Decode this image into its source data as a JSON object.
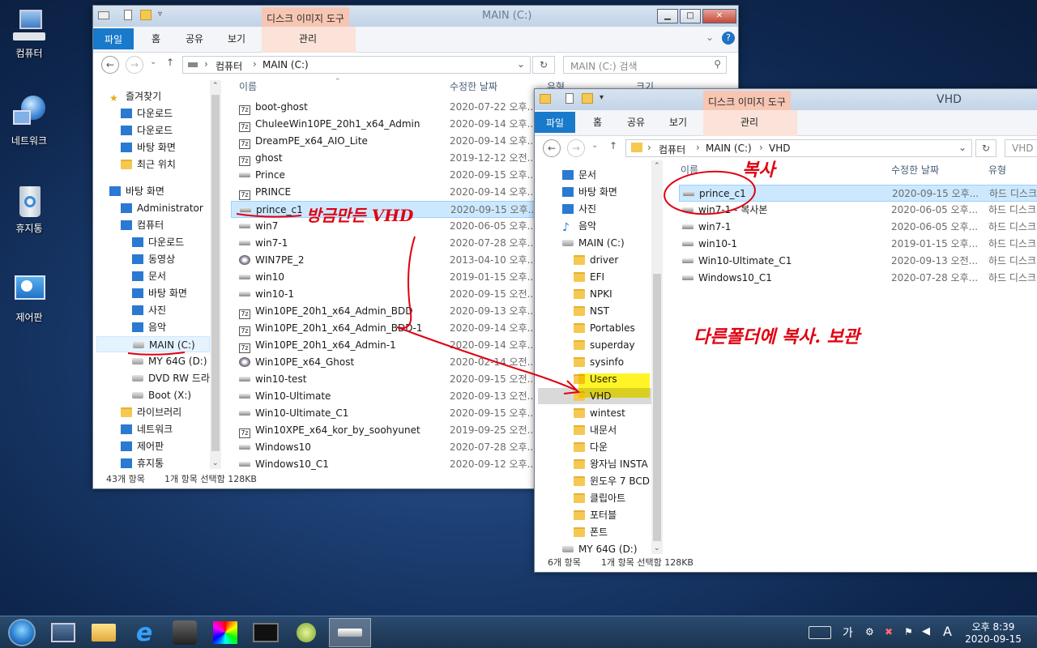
{
  "desktop": {
    "icons": [
      {
        "label": "컴퓨터"
      },
      {
        "label": "네트워크"
      },
      {
        "label": "휴지통"
      },
      {
        "label": "제어판"
      }
    ]
  },
  "win1": {
    "title": "MAIN (C:)",
    "context_tab": "디스크 이미지 도구",
    "tabs": {
      "file": "파일",
      "home": "홈",
      "share": "공유",
      "view": "보기",
      "manage": "관리"
    },
    "address": {
      "computer": "컴퓨터",
      "drive": "MAIN (C:)"
    },
    "search_placeholder": "MAIN (C:) 검색",
    "columns": {
      "name": "이름",
      "date": "수정한 날짜",
      "type": "유형",
      "size": "크기"
    },
    "nav": [
      "즐겨찾기",
      "다운로드",
      "다운로드",
      "바탕 화면",
      "최근 위치",
      "바탕 화면",
      "Administrator",
      "컴퓨터",
      "다운로드",
      "동영상",
      "문서",
      "바탕 화면",
      "사진",
      "음악",
      "MAIN (C:)",
      "MY 64G (D:)",
      "DVD RW 드라이",
      "Boot (X:)",
      "라이브러리",
      "네트워크",
      "제어판",
      "휴지통"
    ],
    "files": [
      {
        "name": "boot-ghost",
        "date": "2020-07-22 오후...",
        "icon": "zip"
      },
      {
        "name": "ChuleeWin10PE_20h1_x64_Admin",
        "date": "2020-09-14 오후...",
        "icon": "zip"
      },
      {
        "name": "DreamPE_x64_AIO_Lite",
        "date": "2020-09-14 오후...",
        "icon": "zip"
      },
      {
        "name": "ghost",
        "date": "2019-12-12 오전...",
        "icon": "zip"
      },
      {
        "name": "Prince",
        "date": "2020-09-15 오후...",
        "icon": "vhd"
      },
      {
        "name": "PRINCE",
        "date": "2020-09-14 오후...",
        "icon": "zip"
      },
      {
        "name": "prince_c1",
        "date": "2020-09-15 오후...",
        "icon": "vhd"
      },
      {
        "name": "win7",
        "date": "2020-06-05 오후...",
        "icon": "vhd"
      },
      {
        "name": "win7-1",
        "date": "2020-07-28 오후...",
        "icon": "vhd"
      },
      {
        "name": "WIN7PE_2",
        "date": "2013-04-10 오후...",
        "icon": "iso"
      },
      {
        "name": "win10",
        "date": "2019-01-15 오후...",
        "icon": "vhd"
      },
      {
        "name": "win10-1",
        "date": "2020-09-15 오전...",
        "icon": "vhd"
      },
      {
        "name": "Win10PE_20h1_x64_Admin_BDD",
        "date": "2020-09-13 오후...",
        "icon": "zip"
      },
      {
        "name": "Win10PE_20h1_x64_Admin_BDD-1",
        "date": "2020-09-14 오후...",
        "icon": "zip"
      },
      {
        "name": "Win10PE_20h1_x64_Admin-1",
        "date": "2020-09-14 오후...",
        "icon": "zip"
      },
      {
        "name": "Win10PE_x64_Ghost",
        "date": "2020-02-14 오전...",
        "icon": "iso"
      },
      {
        "name": "win10-test",
        "date": "2020-09-15 오전...",
        "icon": "vhd"
      },
      {
        "name": "Win10-Ultimate",
        "date": "2020-09-13 오전...",
        "icon": "vhd"
      },
      {
        "name": "Win10-Ultimate_C1",
        "date": "2020-09-15 오후...",
        "icon": "vhd"
      },
      {
        "name": "Win10XPE_x64_kor_by_soohyunet",
        "date": "2019-09-25 오전...",
        "icon": "zip"
      },
      {
        "name": "Windows10",
        "date": "2020-07-28 오후...",
        "icon": "vhd"
      },
      {
        "name": "Windows10_C1",
        "date": "2020-09-12 오후...",
        "icon": "vhd"
      }
    ],
    "status": {
      "count": "43개 항목",
      "selected": "1개 항목 선택함 128KB"
    }
  },
  "win2": {
    "title": "VHD",
    "context_tab": "디스크 이미지 도구",
    "tabs": {
      "file": "파일",
      "home": "홈",
      "share": "공유",
      "view": "보기",
      "manage": "관리"
    },
    "address": {
      "computer": "컴퓨터",
      "drive": "MAIN (C:)",
      "folder": "VHD"
    },
    "search_placeholder": "VHD",
    "columns": {
      "name": "이름",
      "date": "수정한 날짜",
      "type": "유형"
    },
    "nav": [
      "문서",
      "바탕 화면",
      "사진",
      "음악",
      "MAIN (C:)",
      "driver",
      "EFI",
      "NPKI",
      "NST",
      "Portables",
      "superday",
      "sysinfo",
      "Users",
      "VHD",
      "wintest",
      "내문서",
      "다운",
      "왕자님 INSTA",
      "윈도우 7 BCD",
      "클립아트",
      "포터블",
      "폰트",
      "MY 64G (D:)"
    ],
    "files": [
      {
        "name": "prince_c1",
        "date": "2020-09-15 오후...",
        "type": "하드 디스크"
      },
      {
        "name": "win7-1 - 복사본",
        "date": "2020-06-05 오후...",
        "type": "하드 디스크"
      },
      {
        "name": "win7-1",
        "date": "2020-06-05 오후...",
        "type": "하드 디스크"
      },
      {
        "name": "win10-1",
        "date": "2019-01-15 오후...",
        "type": "하드 디스크"
      },
      {
        "name": "Win10-Ultimate_C1",
        "date": "2020-09-13 오전...",
        "type": "하드 디스크"
      },
      {
        "name": "Windows10_C1",
        "date": "2020-07-28 오후...",
        "type": "하드 디스크"
      }
    ],
    "status": {
      "count": "6개 항목",
      "selected": "1개 항목 선택함 128KB"
    }
  },
  "annotations": {
    "copy": "복사",
    "just_made": "방금만든 VHD",
    "store": "다른폴더에 복사. 보관"
  },
  "tray": {
    "time": "오후 8:39",
    "date": "2020-09-15",
    "ime": "가",
    "lang": "A"
  },
  "colors": {
    "accent": "#1979ca",
    "selection": "#cce8ff",
    "annotation": "#e00010",
    "highlight": "#fff200"
  }
}
